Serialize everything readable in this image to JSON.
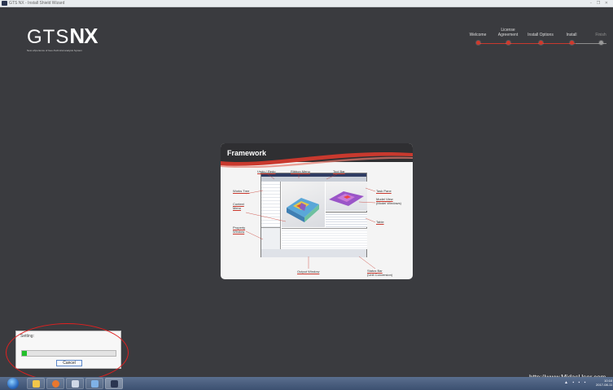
{
  "window": {
    "title": "GTS NX - Install Shield Wizard",
    "controls": "– ❐ ✕"
  },
  "logo": {
    "gts": "GTS",
    "nx": "NX",
    "subtitle": "New eXperience of Geo-Technical analysis System"
  },
  "steps": [
    {
      "label": "Welcome",
      "state": "done"
    },
    {
      "label": "License Agreement",
      "state": "done"
    },
    {
      "label": "Install Options",
      "state": "done"
    },
    {
      "label": "Install",
      "state": "current"
    },
    {
      "label": "Finish",
      "state": "pending"
    }
  ],
  "card": {
    "title": "Framework",
    "callouts": {
      "undo_redo": "Undo / Redo",
      "ribbon_menu": "Ribbon Menu",
      "tool_bar": "Tool Bar",
      "works_tree": "Works Tree",
      "task_pane": "Task Pane",
      "model_view": "Model View",
      "model_view_sub": "(Model Windows)",
      "context_menu": "Context",
      "context_menu_2": "Menu",
      "table": "Table",
      "property_window": "Property",
      "property_window_2": "Window",
      "output_window": "Output Window",
      "status_bar": "Status Bar",
      "status_bar_sub": "(Unit Conversion)"
    }
  },
  "progress": {
    "label": "Setting:",
    "percent": 5,
    "cancel_label": "Cancel"
  },
  "url": "http://www.MidasUser.com",
  "taskbar": {
    "apps": [
      "explorer-icon",
      "firefox-icon",
      "setup-icon",
      "app-icon",
      "installer-icon"
    ],
    "clock_time": "10:10",
    "clock_date": "2017-08-11"
  },
  "colors": {
    "background": "#3a3b3f",
    "accent": "#d0392c",
    "progress": "#22c02a",
    "annotation": "#e12020"
  }
}
